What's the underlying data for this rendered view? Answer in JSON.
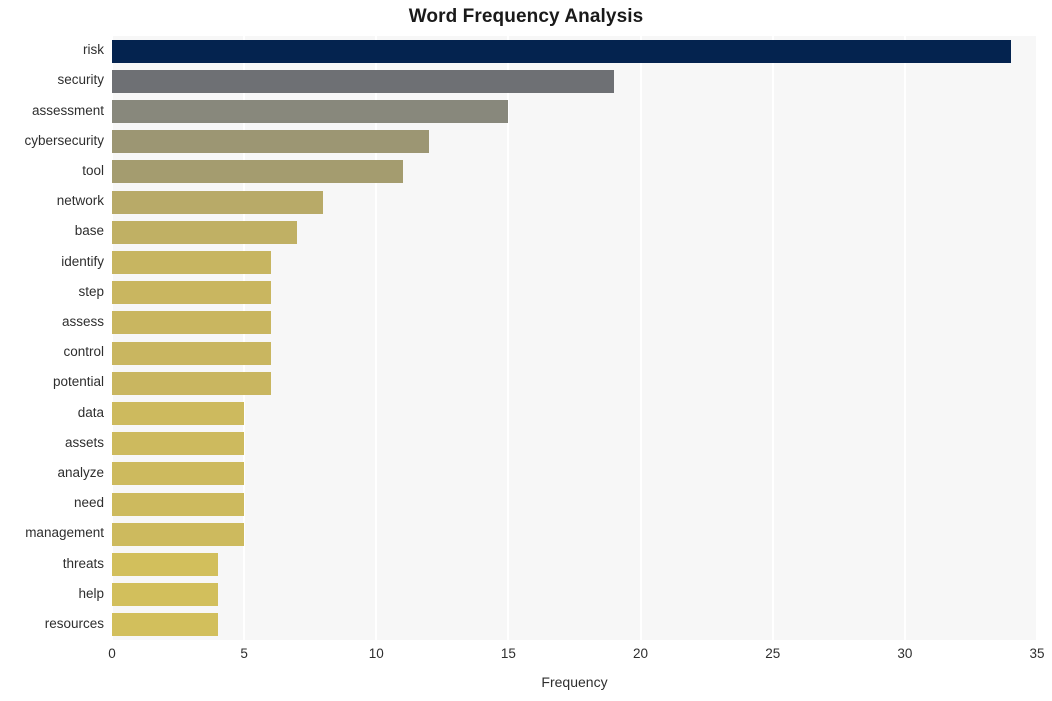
{
  "chart_data": {
    "type": "bar",
    "orientation": "horizontal",
    "title": "Word Frequency Analysis",
    "xlabel": "Frequency",
    "ylabel": "",
    "categories": [
      "risk",
      "security",
      "assessment",
      "cybersecurity",
      "tool",
      "network",
      "base",
      "identify",
      "step",
      "assess",
      "control",
      "potential",
      "data",
      "assets",
      "analyze",
      "need",
      "management",
      "threats",
      "help",
      "resources"
    ],
    "values": [
      34,
      19,
      15,
      12,
      11,
      8,
      7,
      6,
      6,
      6,
      6,
      6,
      5,
      5,
      5,
      5,
      5,
      4,
      4,
      4
    ],
    "bar_colors": [
      "#04234f",
      "#6e7074",
      "#88887c",
      "#9c9673",
      "#a49c6f",
      "#b8aa68",
      "#c0b064",
      "#c7b561",
      "#c9b660",
      "#c9b660",
      "#c9b660",
      "#c9b660",
      "#cdba5e",
      "#cdba5e",
      "#cdba5e",
      "#cdba5e",
      "#cdba5e",
      "#d2bf5c",
      "#d2bf5c",
      "#d2bf5c"
    ],
    "xlim": [
      0,
      35
    ],
    "x_ticks": [
      0,
      5,
      10,
      15,
      20,
      25,
      30,
      35
    ],
    "x_tick_labels": [
      "0",
      "5",
      "10",
      "15",
      "20",
      "25",
      "30",
      "35"
    ],
    "grid": true,
    "grid_axis": "x",
    "grid_color": "#ffffff",
    "plot_background": "#f7f7f7",
    "figure_background": "#ffffff",
    "legend": null
  }
}
